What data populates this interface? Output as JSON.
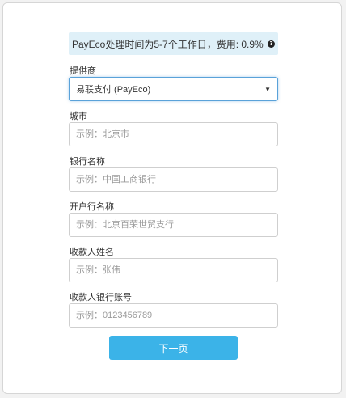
{
  "notice": {
    "text": "PayEco处理时间为5-7个工作日，费用: 0.9%",
    "icon": "question-circle-icon"
  },
  "provider": {
    "label": "提供商",
    "selected": "易联支付 (PayEco)"
  },
  "city": {
    "label": "城市",
    "placeholder": "示例：北京市",
    "value": ""
  },
  "bank_name": {
    "label": "银行名称",
    "placeholder": "示例：中国工商银行",
    "value": ""
  },
  "branch_name": {
    "label": "开户行名称",
    "placeholder": "示例：北京百荣世贸支行",
    "value": ""
  },
  "payee_name": {
    "label": "收款人姓名",
    "placeholder": "示例：张伟",
    "value": ""
  },
  "payee_account": {
    "label": "收款人银行账号",
    "placeholder": "示例：0123456789",
    "value": ""
  },
  "next_button": {
    "label": "下一页",
    "color": "#3bb3e8"
  }
}
